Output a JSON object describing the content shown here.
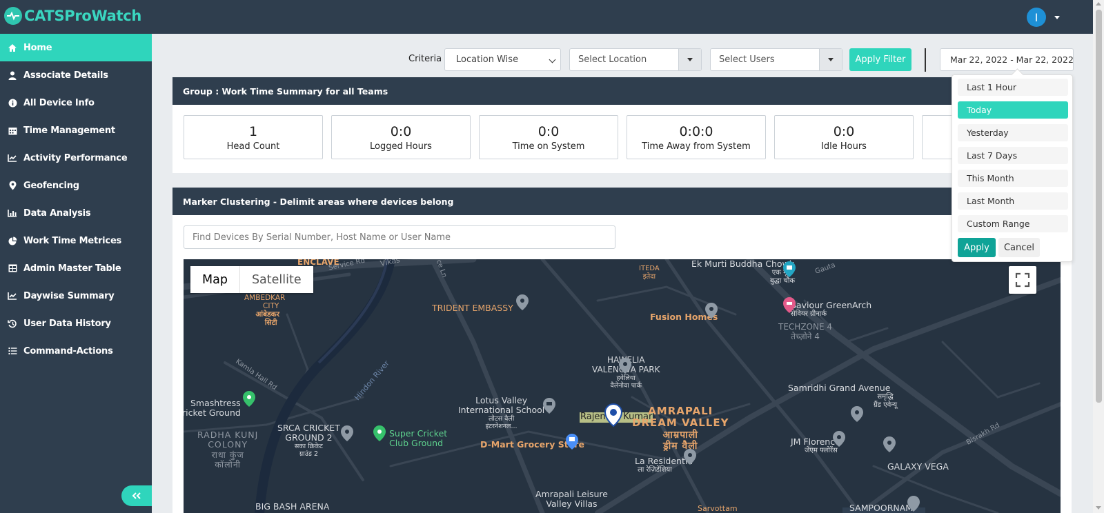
{
  "app": {
    "title": "CATSProWatch",
    "user_initial": "I"
  },
  "sidebar": {
    "items": [
      {
        "label": "Home",
        "icon": "home-icon"
      },
      {
        "label": "Associate Details",
        "icon": "user-icon"
      },
      {
        "label": "All Device Info",
        "icon": "info-icon"
      },
      {
        "label": "Time Management",
        "icon": "calendar-icon"
      },
      {
        "label": "Activity Performance",
        "icon": "line-chart-icon"
      },
      {
        "label": "Geofencing",
        "icon": "map-pin-icon"
      },
      {
        "label": "Data Analysis",
        "icon": "bar-chart-icon"
      },
      {
        "label": "Work Time Metrices",
        "icon": "pie-chart-icon"
      },
      {
        "label": "Admin Master Table",
        "icon": "table-icon"
      },
      {
        "label": "Daywise Summary",
        "icon": "area-chart-icon"
      },
      {
        "label": "User Data History",
        "icon": "history-icon"
      },
      {
        "label": "Command-Actions",
        "icon": "list-icon"
      }
    ],
    "collapse_icon": "double-chevron-left-icon"
  },
  "filters": {
    "criteria_label": "Criteria",
    "criteria_value": "Location Wise",
    "location_placeholder": "Select Location",
    "users_placeholder": "Select Users",
    "apply_label": "Apply Filter",
    "date_range": "Mar 22, 2022 - Mar 22, 2022"
  },
  "summary": {
    "title": "Group : Work Time Summary for all Teams",
    "stats": [
      {
        "value": "1",
        "label": "Head Count"
      },
      {
        "value": "0:0",
        "label": "Logged Hours"
      },
      {
        "value": "0:0",
        "label": "Time on System"
      },
      {
        "value": "0:0:0",
        "label": "Time Away from System"
      },
      {
        "value": "0:0",
        "label": "Idle Hours"
      }
    ]
  },
  "map_panel": {
    "title": "Marker Clustering - Delimit areas where devices belong",
    "search_placeholder": "Find Devices By Serial Number, Host Name or User Name",
    "map_type_map": "Map",
    "map_type_satellite": "Satellite",
    "places": {
      "trident": "TRIDENT EMBASSY",
      "ek_murti": "Ek Murti Buddha Chowk",
      "ek_murti_hi": "एक मूर्ति",
      "ek_murti_hi2": "बुद्धा चौक",
      "itedaa": "ITEDA",
      "itedaa_hi": "इतेदा",
      "saviour": "Saviour GreenArch",
      "saviour_hi": "सेवियर ग्रीनार्क",
      "techzone": "TECHZONE 4",
      "techzone_hi": "तेच्ज़ोने 4",
      "fusion": "Fusion Homes",
      "ambedkar": "AMBEDKAR",
      "ambedkar2": "CITY",
      "ambedkar_hi": "आंबेडकर",
      "ambedkar_hi2": "सिटी",
      "enclave": "ENCLAVE",
      "service_rd": "Service Rd",
      "vikas": "Vikas",
      "hawelia": "HAWELIA",
      "hawelia2": "VALENOVA PARK",
      "hawelia_hi": "हवेलिया",
      "hawelia_hi2": "वैलेनोवा पार्क",
      "samridhi": "Samridhi Grand Avenue",
      "samridhi_hi": "समृद्धि",
      "samridhi_hi2": "ग्रैंड एवेन्यू",
      "kamla": "Kamla Hall Rd",
      "hindon": "Hindon River",
      "smash": "Smashtress",
      "smash2": "ricket Ground",
      "lotus": "Lotus Valley",
      "lotus2": "International School",
      "lotus_hi": "लोटस वैली",
      "lotus_hi2": "इंटरनेशनल...",
      "rajendra": "Rajendra Kumar",
      "amrapali": "AMRAPALI",
      "amrapali2": "DREAM VALLEY",
      "amrapali_hi": "आम्रपाली",
      "amrapali_hi2": "ड्रीम वैली",
      "srca": "SRCA CRICKET",
      "srca2": "GROUND 2",
      "srca_hi": "सका क्रिकेट",
      "srca_hi2": "ग्राउंड 2",
      "super": "Super Cricket",
      "super2": "Club Ground",
      "radha": "RADHA KUNJ",
      "radha2": "COLONY",
      "radha_hi": "राधा कुंज",
      "radha_hi2": "कॉलोनी",
      "dmart": "D-Mart Grocery Store",
      "jm": "JM Florence",
      "jm_hi": "जेएम फ्लोरेंस",
      "galaxy": "GALAXY VEGA",
      "bisrakh": "Bisrakh Rd",
      "residentia": "La Residentia",
      "residentia_hi": "ला रेज़िडेंशिया",
      "leisure": "Amrapali Leisure",
      "leisure2": "Valley Villas",
      "bigbash": "BIG BASH ARENA",
      "sampoornam": "SAMPOORNAM",
      "sarvottam": "Sarvottam",
      "gauta": "Gauta",
      "lane": "ce Ln"
    }
  },
  "date_menu": {
    "ranges": [
      "Last 1 Hour",
      "Today",
      "Yesterday",
      "Last 7 Days",
      "This Month",
      "Last Month",
      "Custom Range"
    ],
    "selected": "Today",
    "apply_label": "Apply",
    "cancel_label": "Cancel"
  },
  "colors": {
    "accent": "#2fd5bc",
    "sidebar_bg": "#2f3e4e",
    "map_bg": "#263341",
    "apply_dark": "#0fa397"
  }
}
